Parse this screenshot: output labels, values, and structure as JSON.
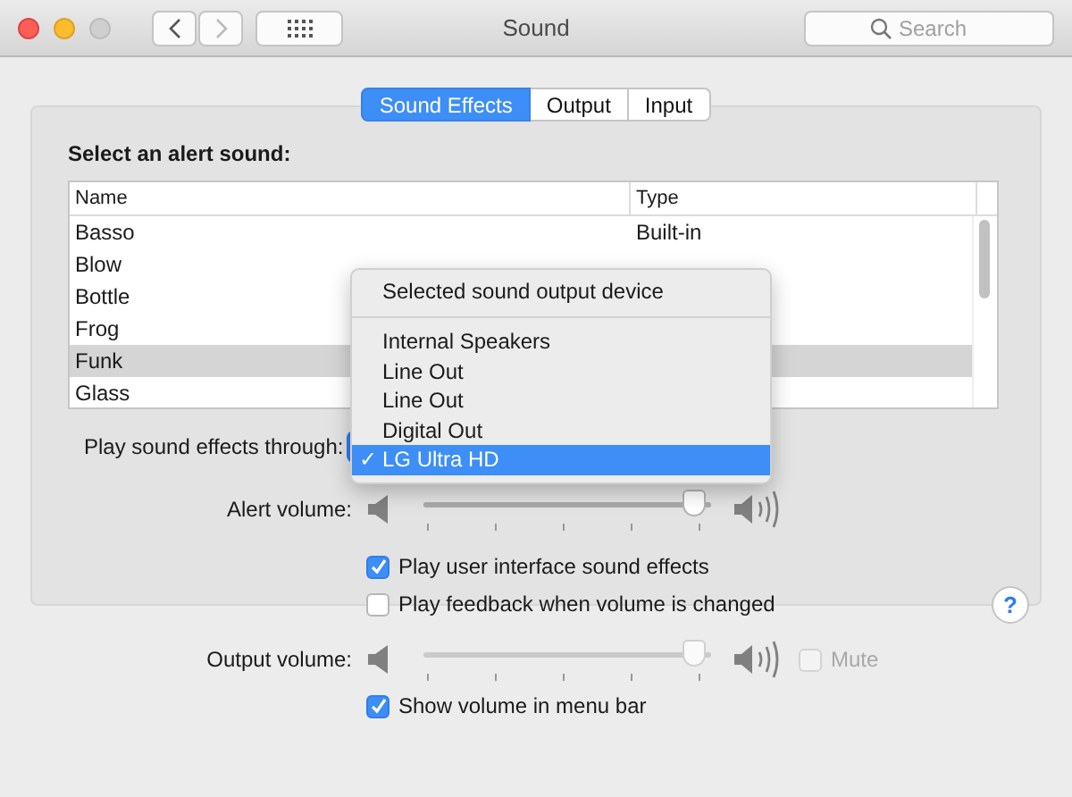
{
  "window": {
    "title": "Sound",
    "search_placeholder": "Search",
    "back_enabled": true,
    "forward_enabled": false
  },
  "tabs": [
    {
      "label": "Sound Effects",
      "selected": true
    },
    {
      "label": "Output",
      "selected": false
    },
    {
      "label": "Input",
      "selected": false
    }
  ],
  "alert_sound": {
    "heading": "Select an alert sound:",
    "columns": [
      "Name",
      "Type"
    ],
    "rows": [
      {
        "name": "Basso",
        "type": "Built-in",
        "selected": false
      },
      {
        "name": "Blow",
        "selected": false
      },
      {
        "name": "Bottle",
        "selected": false
      },
      {
        "name": "Frog",
        "selected": false
      },
      {
        "name": "Funk",
        "selected": true
      },
      {
        "name": "Glass",
        "selected": false
      }
    ]
  },
  "output_menu": {
    "label": "Play sound effects through:",
    "header": "Selected sound output device",
    "items": [
      {
        "label": "Internal Speakers",
        "selected": false
      },
      {
        "label": "Line Out",
        "selected": false
      },
      {
        "label": "Line Out",
        "selected": false
      },
      {
        "label": "Digital Out",
        "selected": false
      },
      {
        "label": "LG Ultra HD",
        "selected": true,
        "check": "✓"
      }
    ]
  },
  "alert_volume": {
    "label": "Alert volume:",
    "level": 0.97
  },
  "options": [
    {
      "label": "Play user interface sound effects",
      "checked": true
    },
    {
      "label": "Play feedback when volume is changed",
      "checked": false
    }
  ],
  "help": "?",
  "output_volume": {
    "label": "Output volume:",
    "level": 0.97,
    "mute": {
      "label": "Mute",
      "checked": false,
      "disabled": true
    }
  },
  "show_volume": {
    "label": "Show volume in menu bar",
    "checked": true
  }
}
